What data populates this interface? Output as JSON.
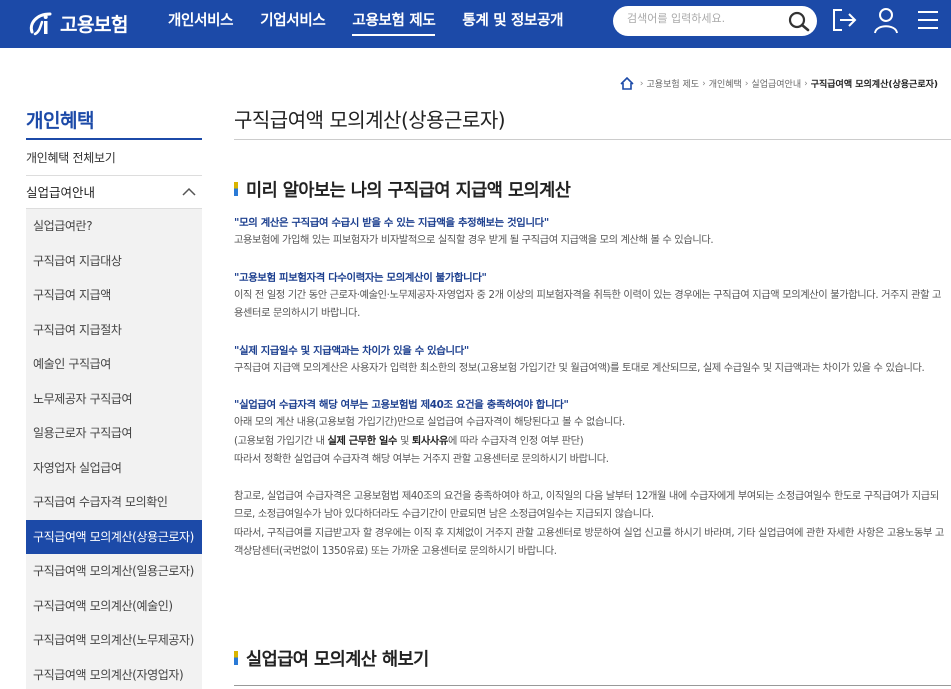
{
  "header": {
    "logo_text": "고용보험",
    "nav": [
      "개인서비스",
      "기업서비스",
      "고용보험 제도",
      "통계 및 정보공개"
    ],
    "active_nav_index": 2,
    "search_placeholder": "검색어를 입력하세요.",
    "icons": [
      "search-icon",
      "logout-icon",
      "user-icon",
      "menu-icon"
    ],
    "brand_color": "#1c4aa8"
  },
  "breadcrumb": {
    "items": [
      "고용보험 제도",
      "개인혜택",
      "실업급여안내"
    ],
    "current": "구직급여액 모의계산(상용근로자)"
  },
  "sidebar": {
    "title": "개인혜택",
    "all_link": "개인혜택 전체보기",
    "group": "실업급여안내",
    "items": [
      "실업급여란?",
      "구직급여 지급대상",
      "구직급여 지급액",
      "구직급여 지급절차",
      "예술인 구직급여",
      "노무제공자 구직급여",
      "일용근로자 구직급여",
      "자영업자 실업급여",
      "구직급여 수급자격 모의확인",
      "구직급여액 모의계산(상용근로자)",
      "구직급여액 모의계산(일용근로자)",
      "구직급여액 모의계산(예술인)",
      "구직급여액 모의계산(노무제공자)",
      "구직급여액 모의계산(자영업자)"
    ],
    "active_index": 9
  },
  "main": {
    "page_title": "구직급여액 모의계산(상용근로자)",
    "section1_title": "미리 알아보는 나의 구직급여 지급액 모의계산",
    "notes": [
      {
        "q": "\"모의 계산은 구직급여 수급시 받을 수 있는 지급액을 추정해보는 것입니다\"",
        "t": "고용보험에 가입해 있는 피보험자가 비자발적으로 실직할 경우 받게 될 구직급여 지급액을 모의 계산해 볼 수 있습니다."
      },
      {
        "q": "\"고용보험 피보험자격 다수이력자는 모의계산이 불가합니다\"",
        "t": "이직 전 일정 기간 동안 근로자·예술인·노무제공자·자영업자 중 2개 이상의 피보험자격을 취득한 이력이 있는 경우에는 구직급여 지급액 모의계산이 불가합니다. 거주지 관할 고용센터로 문의하시기 바랍니다."
      },
      {
        "q": "\"실제 지급일수 및 지급액과는 차이가 있을 수 있습니다\"",
        "t": "구직급여 지급액 모의계산은 사용자가 입력한 최소한의 정보(고용보험 가입기간 및 월급여액)를 토대로 계산되므로, 실제 수급일수 및 지급액과는 차이가 있을 수 있습니다."
      },
      {
        "q": "\"실업급여 수급자격 해당 여부는 고용보험법 제40조 요건을 충족하여야 합니다\"",
        "t1": "아래 모의 계산 내용(고용보험 가입기간)만으로 실업급여 수급자격이 해당된다고 볼 수 없습니다.",
        "t2_pre": "(고용보험 가입기간 내 ",
        "t2_b1": "실제 근무한 일수",
        "t2_mid": " 및 ",
        "t2_b2": "퇴사사유",
        "t2_post": "에 따라 수급자격 인정 여부 판단)",
        "t3": "따라서 정확한 실업급여 수급자격 해당 여부는 거주지 관할 고용센터로 문의하시기 바랍니다."
      }
    ],
    "ref1": "참고로, 실업급여 수급자격은 고용보험법 제40조의 요건을 충족하여야 하고, 이직일의 다음 날부터 12개월 내에 수급자에게 부여되는 소정급여일수 한도로 구직급여가 지급되므로, 소정급여일수가 남아 있다하더라도 수급기간이 만료되면 남은 소정급여일수는 지급되지 않습니다.",
    "ref2": "따라서, 구직급여를 지급받고자 할 경우에는 이직 후 지체없이 거주지 관할 고용센터로 방문하여 실업 신고를 하시기 바라며, 기타 실업급여에 관한 자세한 사항은 고용노동부 고객상담센터(국번없이 1350유료) 또는 가까운 고용센터로 문의하시기 바랍니다.",
    "section2_title": "실업급여 모의계산 해보기"
  }
}
